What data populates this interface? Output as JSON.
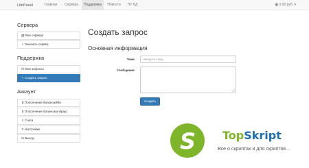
{
  "navbar": {
    "brand": "LitePanel",
    "items": [
      {
        "label": "Главная",
        "active": false
      },
      {
        "label": "Сервера",
        "active": false
      },
      {
        "label": "Поддержка",
        "active": true
      },
      {
        "label": "Новости",
        "active": false
      },
      {
        "label": "ПУ БД",
        "active": false
      }
    ],
    "balance_icon": "wallet-icon",
    "balance": "0.00 руб."
  },
  "sidebar": {
    "servers_title": "Сервера",
    "servers_items": [
      {
        "label": "Мои сервера",
        "icon": "server-icon"
      },
      {
        "label": "Заказать сервер",
        "icon": "plus-icon"
      }
    ],
    "support_title": "Поддержка",
    "support_items": [
      {
        "label": "Мои запросы",
        "icon": "headphones-icon",
        "active": false
      },
      {
        "label": "Создать запрос",
        "icon": "plus-icon",
        "active": true
      }
    ],
    "account_title": "Аккаунт",
    "account_items": [
      {
        "label": "Пополнение баланса(Rk)",
        "icon": "dollar-icon"
      },
      {
        "label": "Пополнение баланса(unitpay)",
        "icon": "dollar-icon"
      },
      {
        "label": "Счета",
        "icon": "list-icon"
      },
      {
        "label": "Настройки",
        "icon": "wrench-icon"
      },
      {
        "label": "Выход",
        "icon": "power-icon"
      }
    ]
  },
  "main": {
    "title": "Создать запрос",
    "section": "Основная информация",
    "subject_label": "Тема:",
    "subject_placeholder": "Введите тему",
    "message_label": "Сообщение:",
    "submit": "Создать"
  },
  "watermark": {
    "logo_letter": "S",
    "brand_part1": "Top",
    "brand_part2": "Skript",
    "tagline": "Все о скриптах и для скриптов..."
  },
  "colors": {
    "primary": "#337ab7",
    "navbar_bg": "#f8f8f8",
    "brand_green": "#7fb52a",
    "brand_blue": "#1f6fae"
  }
}
